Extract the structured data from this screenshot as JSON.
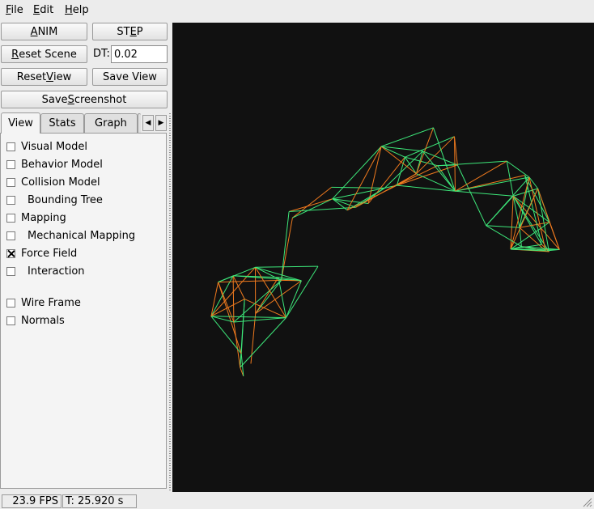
{
  "menubar": {
    "file": {
      "mn": "F",
      "rest": "ile"
    },
    "edit": {
      "mn": "E",
      "rest": "dit"
    },
    "help": {
      "mn": "H",
      "rest": "elp"
    }
  },
  "controls": {
    "anim": {
      "pre": "",
      "mn": "A",
      "post": "NIM"
    },
    "step": {
      "pre": "ST",
      "mn": "E",
      "post": "P"
    },
    "reset_scene": {
      "pre": "",
      "mn": "R",
      "post": "eset Scene"
    },
    "dt_label": "DT:",
    "dt_value": "0.02",
    "reset_view": {
      "pre": "Reset ",
      "mn": "V",
      "post": "iew"
    },
    "save_view": "Save View",
    "save_screenshot": {
      "pre": "Save ",
      "mn": "S",
      "post": "creenshot"
    }
  },
  "tabs": [
    "View",
    "Stats",
    "Graph"
  ],
  "view_options": [
    {
      "label": "Visual Model",
      "checked": false
    },
    {
      "label": "Behavior Model",
      "checked": false
    },
    {
      "label": "Collision Model",
      "checked": false
    },
    {
      "label": "Bounding Tree",
      "checked": false
    },
    {
      "label": "Mapping",
      "checked": false
    },
    {
      "label": "Mechanical Mapping",
      "checked": false
    },
    {
      "label": "Force Field",
      "checked": true
    },
    {
      "label": "Interaction",
      "checked": false
    },
    {
      "label": "Wire Frame",
      "checked": false
    },
    {
      "label": "Normals",
      "checked": false
    }
  ],
  "status": {
    "fps": "23.9 FPS",
    "time": "T: 25.920 s"
  },
  "colors": {
    "mesh_green": "#3de87a",
    "mesh_orange": "#f07a1e",
    "viewport_bg": "#111111"
  }
}
